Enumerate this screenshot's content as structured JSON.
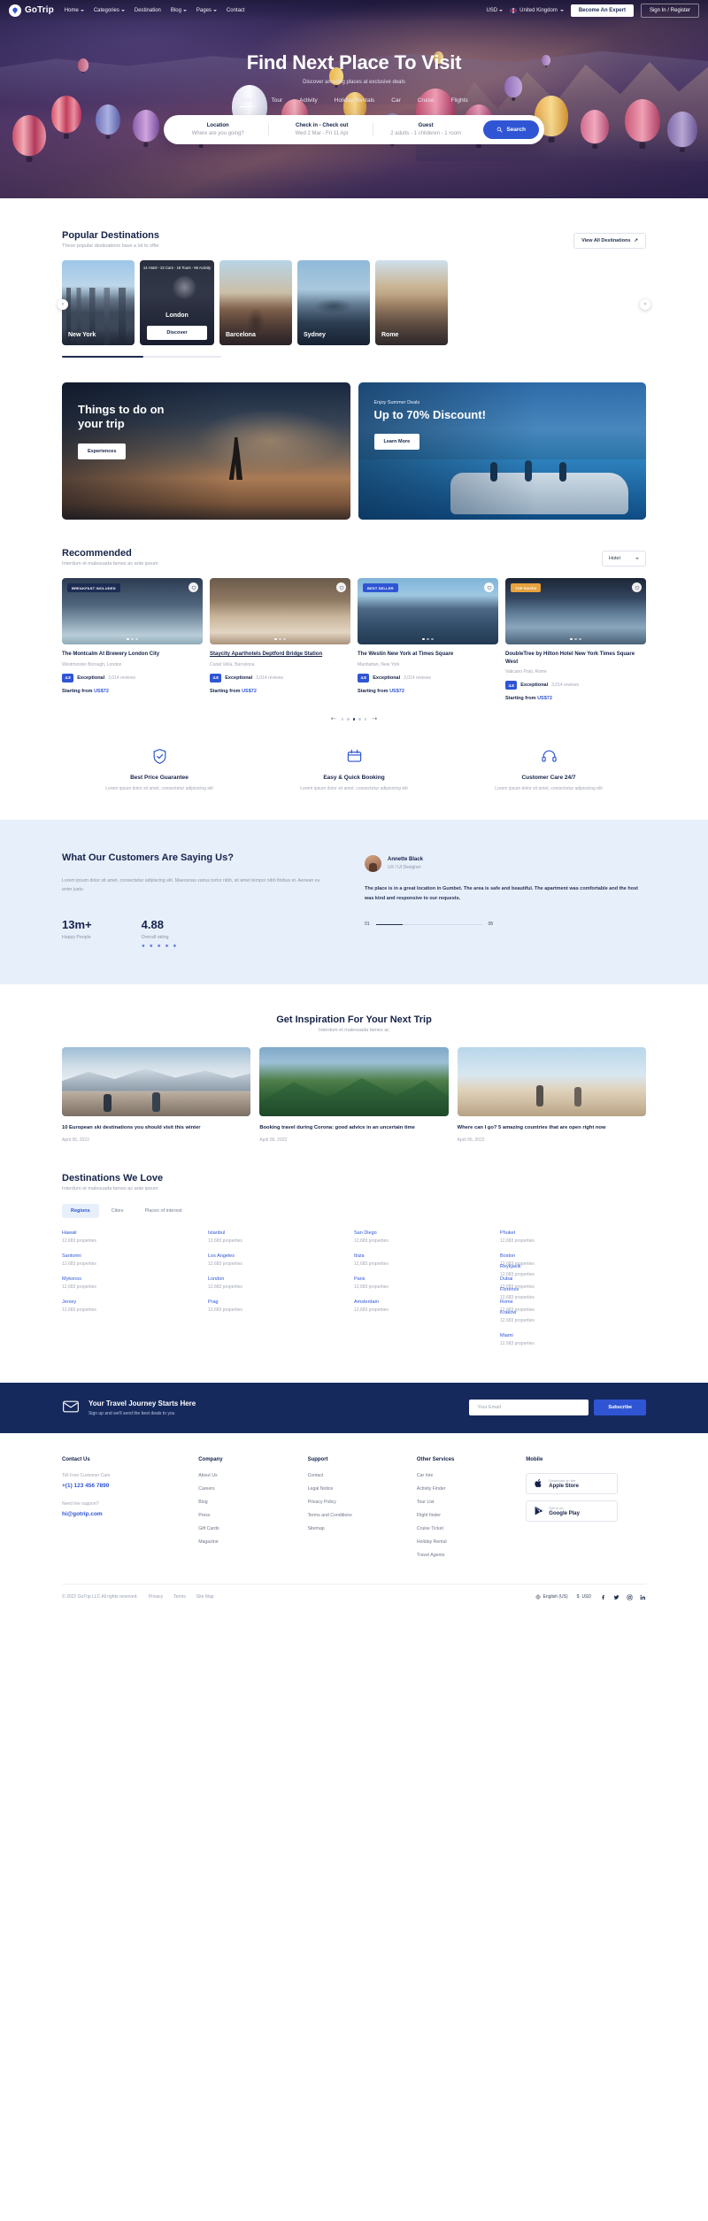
{
  "header": {
    "brand": "GoTrip",
    "nav": [
      {
        "label": "Home",
        "caret": true
      },
      {
        "label": "Categories",
        "caret": true
      },
      {
        "label": "Destination",
        "caret": false
      },
      {
        "label": "Blog",
        "caret": true
      },
      {
        "label": "Pages",
        "caret": true
      },
      {
        "label": "Contact",
        "caret": false
      }
    ],
    "currency": "USD",
    "country": "United Kingdom",
    "become_expert": "Become An Expert",
    "sign_in": "Sign In / Register"
  },
  "hero": {
    "title": "Find Next Place To Visit",
    "subtitle": "Discover amazing places at exclusive deals",
    "tabs": [
      "Hotel",
      "Tour",
      "Activity",
      "Holiday Rentals",
      "Car",
      "Cruise",
      "Flights"
    ],
    "active_tab": "Hotel",
    "search": {
      "location_label": "Location",
      "location_value": "Where are you going?",
      "dates_label": "Check in - Check out",
      "dates_value": "Wed 2 Mar  -  Fri 11 Apr",
      "guest_label": "Guest",
      "guest_value": "2 adults - 1 childeren - 1 room",
      "button": "Search"
    }
  },
  "popular": {
    "title": "Popular Destinations",
    "subtitle": "These popular destinations have a lot to offer",
    "view_all": "View All Destinations",
    "cards": [
      {
        "name": "New York",
        "badge": "",
        "cta": ""
      },
      {
        "name": "London",
        "badge": "14 Hotel - 22 Cars - 18 Tours - 96 Activity",
        "cta": "Discover"
      },
      {
        "name": "Barcelona",
        "badge": "",
        "cta": ""
      },
      {
        "name": "Sydney",
        "badge": "",
        "cta": ""
      },
      {
        "name": "Rome",
        "badge": "",
        "cta": ""
      }
    ]
  },
  "promo": [
    {
      "tag": "",
      "title": "Things to do on your trip",
      "button": "Experiences"
    },
    {
      "tag": "Enjoy Summer Deals",
      "title": "Up to 70% Discount!",
      "button": "Learn More"
    }
  ],
  "recommended": {
    "title": "Recommended",
    "subtitle": "Interdum et malesuada fames ac ante ipsum",
    "filter": "Hotel",
    "hotels": [
      {
        "tag": "BREAKFAST INCLUDED",
        "tag_color": "#1c2c54",
        "name": "The Montcalm At Brewery London City",
        "location": "Westminster Borough, London",
        "score": "4.8",
        "word": "Exceptional",
        "reviews": "3,014 reviews",
        "price_prefix": "Starting from ",
        "price": "US$72"
      },
      {
        "tag": "",
        "tag_color": "",
        "name": "Staycity Aparthotels Deptford Bridge Station",
        "location": "Ciutat Vella, Barcelona",
        "score": "4.8",
        "word": "Exceptional",
        "reviews": "3,014 reviews",
        "price_prefix": "Starting from ",
        "price": "US$72"
      },
      {
        "tag": "BEST SELLER",
        "tag_color": "#2f55d4",
        "name": "The Westin New York at Times Square",
        "location": "Manhattan, New York",
        "score": "4.8",
        "word": "Exceptional",
        "reviews": "3,014 reviews",
        "price_prefix": "Starting from ",
        "price": "US$72"
      },
      {
        "tag": "TOP RATED",
        "tag_color": "#e8a33d",
        "name": "DoubleTree by Hilton Hotel New York Times Square West",
        "location": "Vaticano Prati, Rome",
        "score": "4.8",
        "word": "Exceptional",
        "reviews": "3,014 reviews",
        "price_prefix": "Starting from ",
        "price": "US$72"
      }
    ]
  },
  "features": [
    {
      "icon": "shield-icon",
      "title": "Best Price Guarantee",
      "desc": "Lorem ipsum dolor sit amet, consectetur adipisicing elit"
    },
    {
      "icon": "booking-icon",
      "title": "Easy & Quick Booking",
      "desc": "Lorem ipsum dolor sit amet, consectetur adipisicing elit"
    },
    {
      "icon": "support-icon",
      "title": "Customer Care 24/7",
      "desc": "Lorem ipsum dolor sit amet, consectetur adipisicing elit"
    }
  ],
  "testimonial": {
    "heading": "What Our Customers Are Saying Us?",
    "paragraph": "Lorem ipsum dolor sit amet, consectetur adipiscing elit. Maecenas varius tortor nibh, sit amet tempor nibh finibus et. Aenean eu enim justo.",
    "stats": [
      {
        "number": "13m+",
        "label": "Happy People"
      },
      {
        "number": "4.88",
        "label": "Overall rating",
        "stars": "★ ★ ★ ★ ★"
      }
    ],
    "person_name": "Annette Black",
    "person_role": "UX / UI Designer",
    "quote": "The place is in a great location in Gumbet. The area is safe and beautiful. The apartment was comfortable and the host was kind and responsive to our requests.",
    "page_current": "01",
    "page_total": "05"
  },
  "inspiration": {
    "title": "Get Inspiration For Your Next Trip",
    "subtitle": "Interdum et malesuada fames ac",
    "posts": [
      {
        "title": "10 European ski destinations you should visit this winter",
        "date": "April 06, 2022"
      },
      {
        "title": "Booking travel during Corona: good advice in an uncertain time",
        "date": "April 06, 2022"
      },
      {
        "title": "Where can I go? 5 amazing countries that are open right now",
        "date": "April 06, 2022"
      }
    ]
  },
  "love": {
    "title": "Destinations We Love",
    "subtitle": "Interdum et malesuada fames ac ante ipsum",
    "tabs": [
      "Regions",
      "Cities",
      "Places of interest"
    ],
    "active_tab": "Regions",
    "items": [
      {
        "city": "Hawaii",
        "count": "12,683 properties"
      },
      {
        "city": "Istanbul",
        "count": "12,683 properties"
      },
      {
        "city": "San Diego",
        "count": "12,683 properties"
      },
      {
        "city": "Phuket",
        "count": "12,683 properties"
      },
      {
        "city": "Reykjavik",
        "count": "12,683 properties"
      },
      {
        "city": "Santorini",
        "count": "12,683 properties"
      },
      {
        "city": "Los Angeles",
        "count": "12,683 properties"
      },
      {
        "city": "Ibiza",
        "count": "12,683 properties"
      },
      {
        "city": "Boston",
        "count": "12,683 properties"
      },
      {
        "city": "Florence",
        "count": "12,683 properties"
      },
      {
        "city": "Mykonos",
        "count": "12,683 properties"
      },
      {
        "city": "London",
        "count": "12,683 properties"
      },
      {
        "city": "Paris",
        "count": "12,683 properties"
      },
      {
        "city": "Dubai",
        "count": "12,683 properties"
      },
      {
        "city": "Krakow",
        "count": "12,683 properties"
      },
      {
        "city": "Jersey",
        "count": "12,683 properties"
      },
      {
        "city": "Prag",
        "count": "12,683 properties"
      },
      {
        "city": "Amsterdam",
        "count": "12,683 properties"
      },
      {
        "city": "Rome",
        "count": "12,683 properties"
      },
      {
        "city": "Miami",
        "count": "12,683 properties"
      }
    ]
  },
  "newsletter": {
    "title": "Your Travel Journey Starts Here",
    "subtitle": "Sign up and we'll send the best deals to you",
    "placeholder": "Your Email",
    "button": "Subscribe"
  },
  "footer": {
    "columns": [
      {
        "heading": "Contact Us",
        "sub1": "Toll Free Customer Care",
        "strong1": "+(1) 123 456 7890",
        "sub2": "Need live support?",
        "strong2": "hi@gotrip.com"
      },
      {
        "heading": "Company",
        "links": [
          "About Us",
          "Careers",
          "Blog",
          "Press",
          "Gift Cards",
          "Magazine"
        ]
      },
      {
        "heading": "Support",
        "links": [
          "Contact",
          "Legal Notice",
          "Privacy Policy",
          "Terms and Conditions",
          "Sitemap"
        ]
      },
      {
        "heading": "Other Services",
        "links": [
          "Car hire",
          "Activity Finder",
          "Tour List",
          "Flight finder",
          "Cruise Ticket",
          "Holiday Rental",
          "Travel Agents"
        ]
      }
    ],
    "mobile_heading": "Mobile",
    "stores": [
      {
        "small": "Download on the",
        "big": "Apple Store",
        "icon": "apple-icon"
      },
      {
        "small": "Get in on",
        "big": "Google Play",
        "icon": "google-play-icon"
      }
    ],
    "copyright": "© 2022 GoTrip LLC All rights reserved.",
    "bottom_links": [
      "Privacy",
      "Terms",
      "Site Map"
    ],
    "language": "English (US)",
    "currency": "USD"
  }
}
